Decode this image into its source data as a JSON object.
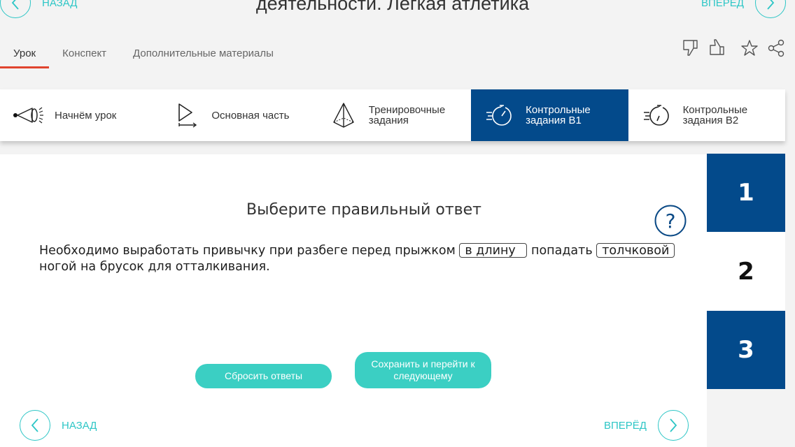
{
  "header": {
    "title": "деятельности. Легкая атлетика",
    "back_label": "НАЗАД",
    "forward_label": "ВПЕРЁД"
  },
  "tabs": [
    {
      "label": "Урок",
      "active": true
    },
    {
      "label": "Конспект",
      "active": false
    },
    {
      "label": "Дополнительные материалы",
      "active": false
    }
  ],
  "actions": [
    "dislike-icon",
    "like-icon",
    "star-icon",
    "share-icon"
  ],
  "sections": [
    {
      "label": "Начнём урок",
      "icon": "megaphone-icon",
      "active": false
    },
    {
      "label": "Основная часть",
      "icon": "play-icon",
      "active": false
    },
    {
      "label": "Тренировочные задания",
      "icon": "pyramid-icon",
      "active": false
    },
    {
      "label": "Контрольные задания В1",
      "icon": "stopwatch-icon",
      "active": true
    },
    {
      "label": "Контрольные задания В2",
      "icon": "stopwatch-icon",
      "active": false
    }
  ],
  "task": {
    "heading": "Выберите правильный ответ",
    "text_part1": "Необходимо выработать привычку при разбеге перед прыжком",
    "blank1": "в длину",
    "text_part2": "попадать",
    "blank2": "толчковой",
    "text_part3": "ногой на брусок для отталкивания."
  },
  "buttons": {
    "reset": "Сбросить ответы",
    "save": "Сохранить и перейти к следующему"
  },
  "footer": {
    "back_label": "НАЗАД",
    "forward_label": "ВПЕРЁД"
  },
  "question_numbers": [
    {
      "label": "1",
      "state": "done"
    },
    {
      "label": "2",
      "state": "current"
    },
    {
      "label": "3",
      "state": "done"
    }
  ],
  "colors": {
    "accent": "#2dc6c6",
    "button": "#3bcfc3",
    "primary_dark": "#034a8b",
    "tab_underline": "#e0442e"
  }
}
